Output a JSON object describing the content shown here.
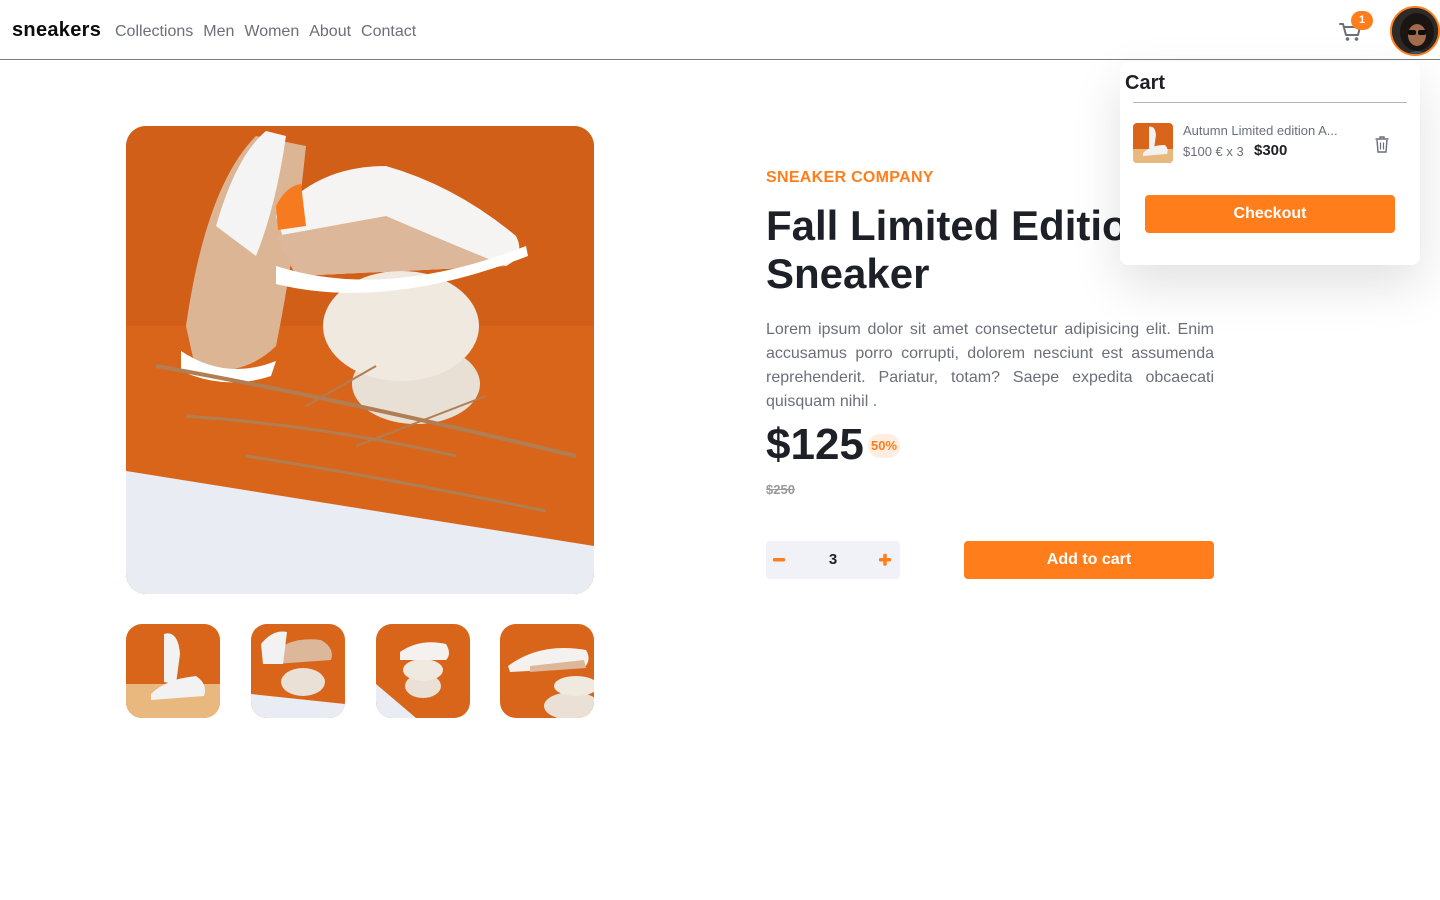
{
  "header": {
    "logo": "sneakers",
    "nav": [
      "Collections",
      "Men",
      "Women",
      "About",
      "Contact"
    ],
    "cart_count": "1"
  },
  "product": {
    "company": "SNEAKER COMPANY",
    "title": "Fall Limited Edition Sneaker",
    "description": "Lorem ipsum dolor sit amet consectetur adipisicing elit. Enim accusamus porro corrupti, dolorem nesciunt est assumenda reprehenderit. Pariatur, totam? Saepe expedita obcaecati quisquam nihil .",
    "price": "$125",
    "discount": "50%",
    "old_price": "$250",
    "quantity": "3",
    "add_to_cart": "Add to cart"
  },
  "cart": {
    "title": "Cart",
    "item_name": "Autumn Limited edition A...",
    "item_line": "$100 € x 3",
    "item_total": "$300",
    "checkout": "Checkout"
  },
  "colors": {
    "accent": "#ff7e1b",
    "text_dark": "#1d2026",
    "text_muted": "#6b6f7a",
    "photo_orange": "#d9651b"
  }
}
